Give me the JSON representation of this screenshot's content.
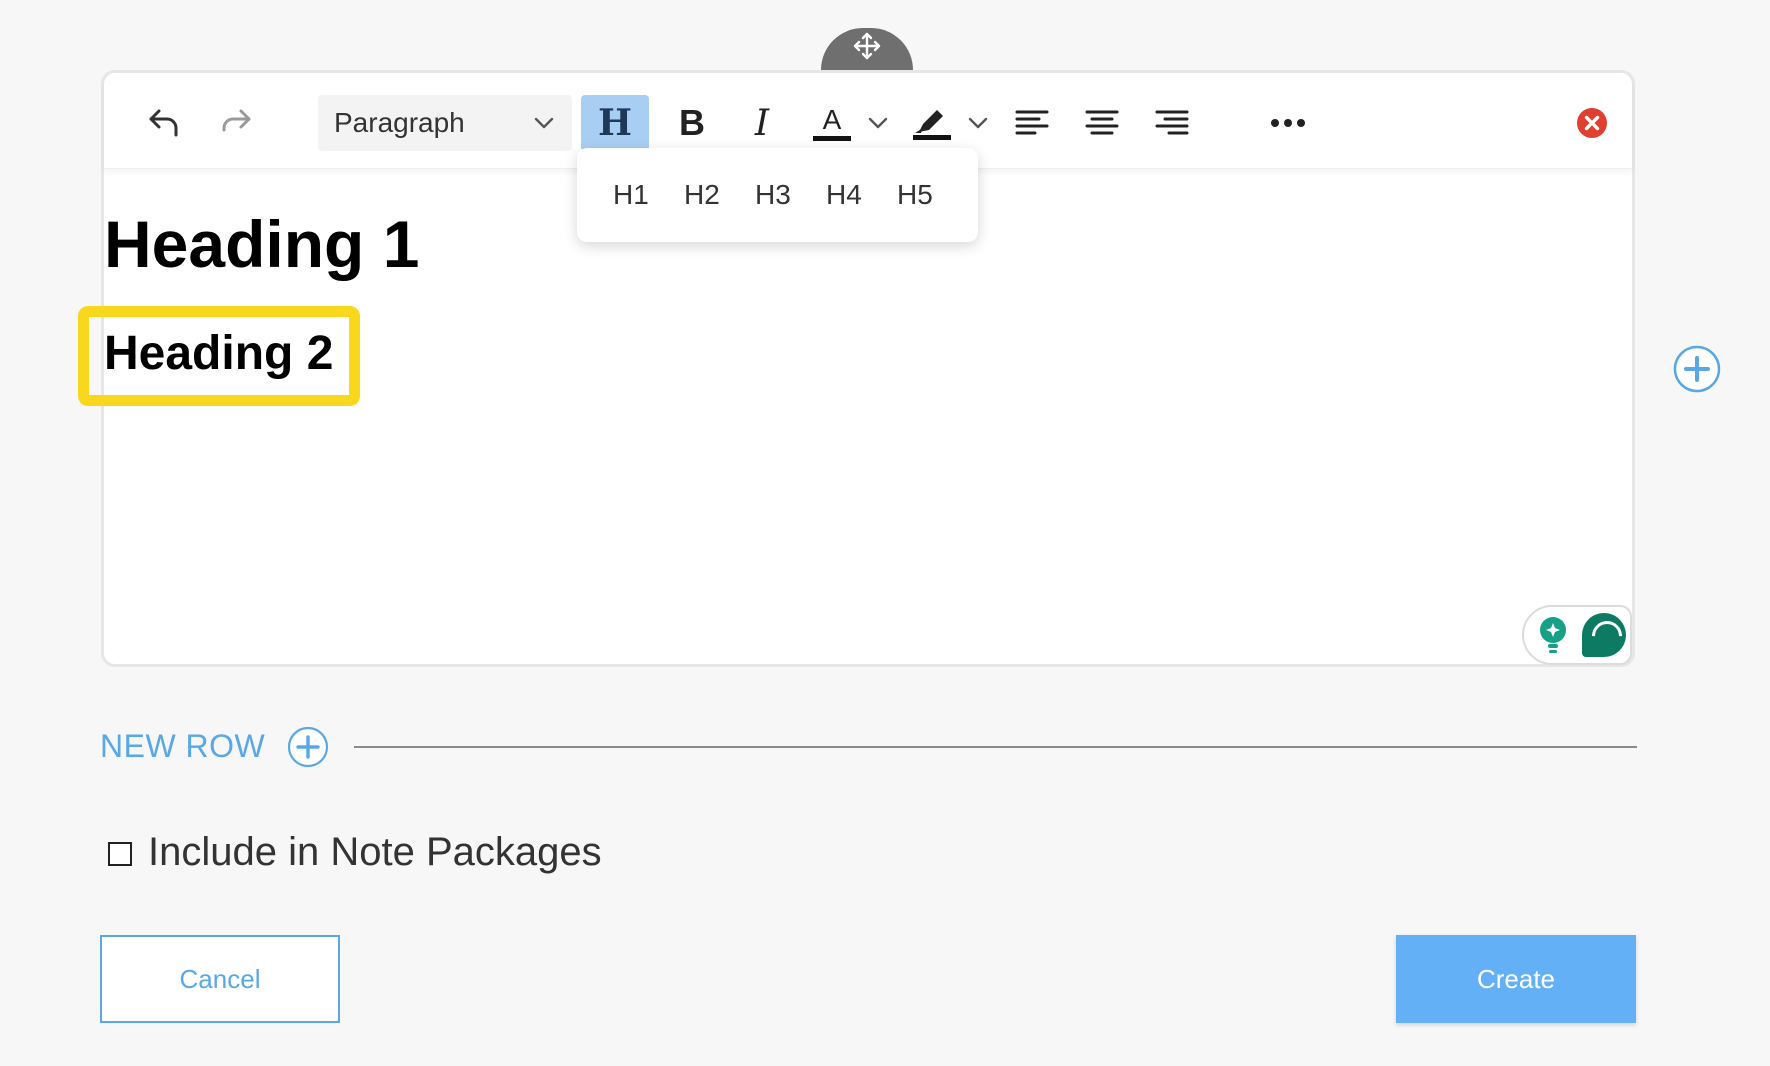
{
  "toolbar": {
    "paragraph_select": "Paragraph",
    "heading_icon": "H",
    "bold_icon": "B",
    "italic_icon": "I",
    "font_color_icon": "A",
    "heading_options": [
      "H1",
      "H2",
      "H3",
      "H4",
      "H5"
    ],
    "icons": [
      "undo-icon",
      "redo-icon",
      "chevron-down-icon",
      "font-color-icon",
      "highlighter-icon",
      "align-left-icon",
      "align-center-icon",
      "align-right-icon",
      "more-icon",
      "close-icon"
    ]
  },
  "editor": {
    "heading1": "Heading 1",
    "heading2": "Heading 2"
  },
  "new_row": {
    "label": "NEW ROW"
  },
  "include_packages": {
    "label": "Include in Note Packages",
    "checked": false
  },
  "actions": {
    "cancel_label": "Cancel",
    "create_label": "Create"
  },
  "colors": {
    "accent": "#5aa7e8",
    "create_bg": "#64b0f6",
    "heading_active_bg": "#a9cef4",
    "highlight": "#f9d71c",
    "close_red": "#e0402f",
    "widget_green": "#0d7a63"
  }
}
